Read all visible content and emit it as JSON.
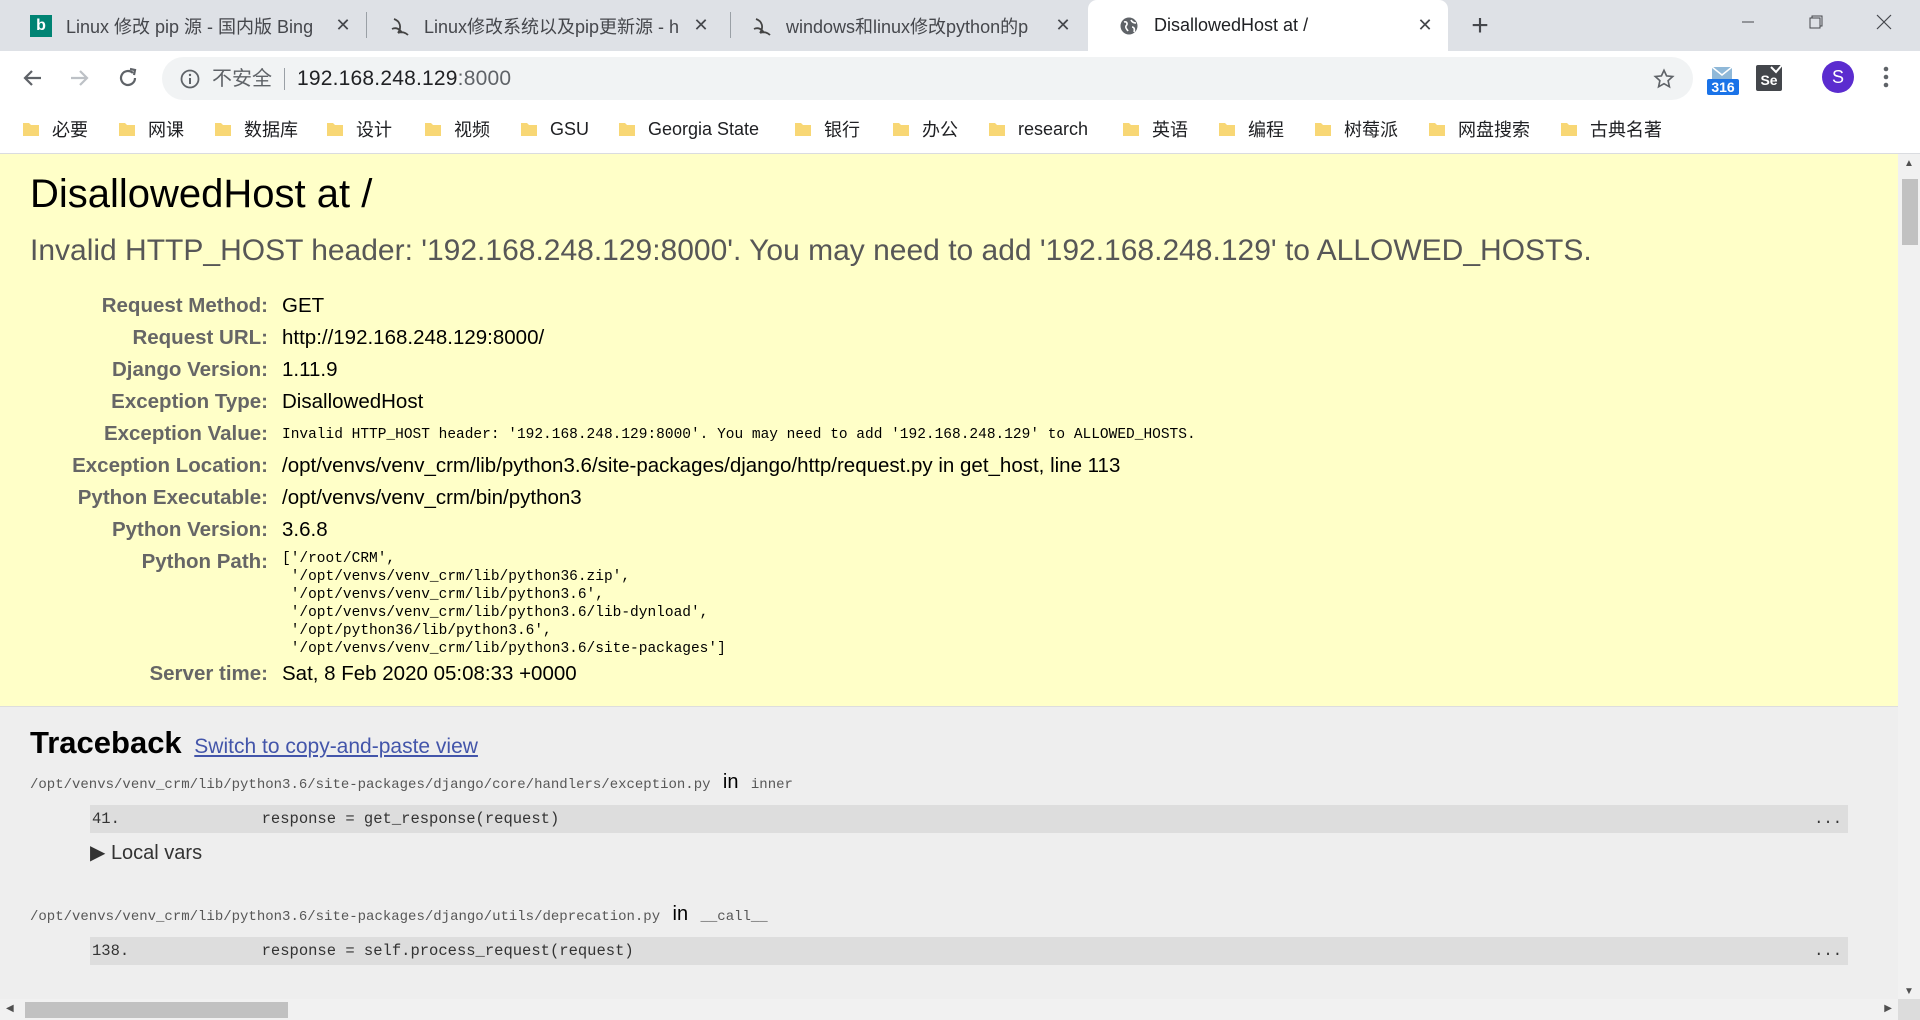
{
  "tabs": [
    {
      "title": "Linux 修改 pip 源 - 国内版 Bing",
      "icon": "bing-icon"
    },
    {
      "title": "Linux修改系统以及pip更新源 - h",
      "icon": "site-icon"
    },
    {
      "title": "windows和linux修改python的p",
      "icon": "site-icon"
    },
    {
      "title": "DisallowedHost at /",
      "icon": "globe-icon",
      "active": true
    }
  ],
  "toolbar": {
    "insecure_label": "不安全",
    "url_host": "192.168.248.129",
    "url_port": ":8000",
    "extension_badge": "316",
    "profile_initial": "S"
  },
  "bookmarks": [
    "必要",
    "网课",
    "数据库",
    "设计",
    "视频",
    "GSU",
    "Georgia State",
    "银行",
    "办公",
    "research",
    "英语",
    "编程",
    "树莓派",
    "网盘搜索",
    "古典名著"
  ],
  "page": {
    "title": "DisallowedHost at /",
    "subtitle": "Invalid HTTP_HOST header: '192.168.248.129:8000'. You may need to add '192.168.248.129' to ALLOWED_HOSTS.",
    "meta": [
      {
        "key": "Request Method:",
        "value": "GET"
      },
      {
        "key": "Request URL:",
        "value": "http://192.168.248.129:8000/"
      },
      {
        "key": "Django Version:",
        "value": "1.11.9"
      },
      {
        "key": "Exception Type:",
        "value": "DisallowedHost"
      },
      {
        "key": "Exception Value:",
        "value": "Invalid HTTP_HOST header: '192.168.248.129:8000'. You may need to add '192.168.248.129' to ALLOWED_HOSTS."
      },
      {
        "key": "Exception Location:",
        "value": "/opt/venvs/venv_crm/lib/python3.6/site-packages/django/http/request.py in get_host, line 113"
      },
      {
        "key": "Python Executable:",
        "value": "/opt/venvs/venv_crm/bin/python3"
      },
      {
        "key": "Python Version:",
        "value": "3.6.8"
      },
      {
        "key": "Python Path:",
        "value": "['/root/CRM',\n '/opt/venvs/venv_crm/lib/python36.zip',\n '/opt/venvs/venv_crm/lib/python3.6',\n '/opt/venvs/venv_crm/lib/python3.6/lib-dynload',\n '/opt/python36/lib/python3.6',\n '/opt/venvs/venv_crm/lib/python3.6/site-packages']"
      },
      {
        "key": "Server time:",
        "value": "Sat, 8 Feb 2020 05:08:33 +0000"
      }
    ],
    "traceback": {
      "heading": "Traceback",
      "switch_link": "Switch to copy-and-paste view",
      "frames": [
        {
          "file": "/opt/venvs/venv_crm/lib/python3.6/site-packages/django/core/handlers/exception.py",
          "in": "in",
          "func": "inner",
          "line_no": "41.",
          "code": "            response = get_response(request)",
          "dots": "...",
          "local_vars": "▶ Local vars"
        },
        {
          "file": "/opt/venvs/venv_crm/lib/python3.6/site-packages/django/utils/deprecation.py",
          "in": "in",
          "func": "__call__",
          "line_no": "138.",
          "code": "            response = self.process_request(request)",
          "dots": "..."
        }
      ]
    }
  },
  "colors": {
    "summary_bg": "#ffffc8",
    "traceback_bg": "#eeeeee",
    "link": "#4355aa",
    "tabstrip_bg": "#dee1e6",
    "folder": "#f8d775"
  }
}
